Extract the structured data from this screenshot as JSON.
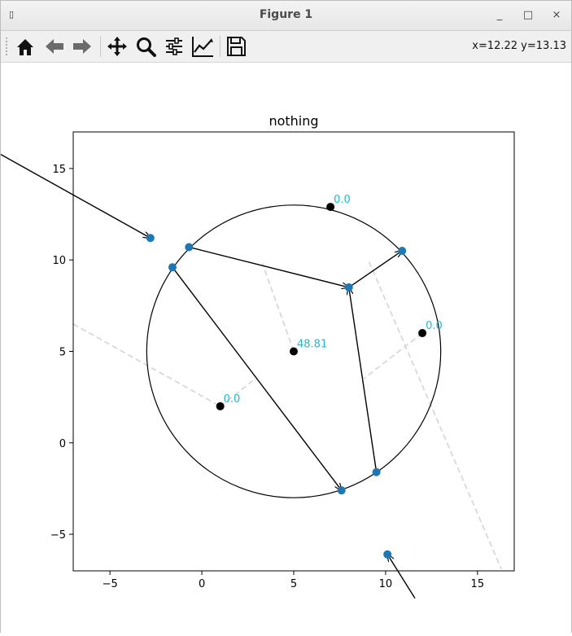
{
  "window": {
    "title": "Figure 1",
    "buttons": {
      "minimize": "_",
      "maximize": "□",
      "close": "×"
    }
  },
  "toolbar": {
    "items": [
      {
        "name": "home-icon"
      },
      {
        "name": "back-icon"
      },
      {
        "name": "forward-icon"
      },
      {
        "name": "pan-icon"
      },
      {
        "name": "zoom-icon"
      },
      {
        "name": "configure-subplots-icon"
      },
      {
        "name": "edit-axes-icon"
      },
      {
        "name": "save-icon"
      }
    ],
    "coords": "x=12.22 y=13.13"
  },
  "colors": {
    "blue_points": "#1f77b4",
    "black_points": "#000000",
    "label_color": "#17becf",
    "dashed_lines": "#d9d9d9"
  },
  "chart_data": {
    "type": "scatter",
    "title": "nothing",
    "xlim": [
      -7,
      17
    ],
    "ylim": [
      -7,
      17
    ],
    "xticks": [
      -5,
      0,
      5,
      10,
      15
    ],
    "yticks": [
      -5,
      0,
      5,
      10,
      15
    ],
    "circle": {
      "center": [
        5,
        5
      ],
      "radius": 8
    },
    "blue_points": [
      [
        -2.8,
        11.2
      ],
      [
        -0.7,
        10.7
      ],
      [
        -1.6,
        9.6
      ],
      [
        8.0,
        8.5
      ],
      [
        10.9,
        10.5
      ],
      [
        9.5,
        -1.6
      ],
      [
        7.6,
        -2.6
      ],
      [
        10.1,
        -6.1
      ]
    ],
    "black_points": [
      {
        "x": 7.0,
        "y": 12.9,
        "label": "0.0"
      },
      {
        "x": 12.0,
        "y": 6.0,
        "label": "0.0"
      },
      {
        "x": 5.0,
        "y": 5.0,
        "label": "48.81"
      },
      {
        "x": 1.0,
        "y": 2.0,
        "label": "0.0"
      }
    ],
    "arrows": [
      {
        "from": [
          -11.0,
          15.8
        ],
        "to": [
          -2.8,
          11.2
        ]
      },
      {
        "from": [
          -0.7,
          10.7
        ],
        "to": [
          8.0,
          8.5
        ]
      },
      {
        "from": [
          8.0,
          8.5
        ],
        "to": [
          10.9,
          10.5
        ]
      },
      {
        "from": [
          9.5,
          -1.6
        ],
        "to": [
          8.0,
          8.5
        ]
      },
      {
        "from": [
          -1.6,
          9.6
        ],
        "to": [
          7.6,
          -2.6
        ]
      },
      {
        "from": [
          11.6,
          -8.5
        ],
        "to": [
          10.1,
          -6.1
        ]
      }
    ],
    "dashed_lines": [
      {
        "from": [
          5.0,
          5.0
        ],
        "to": [
          3.3,
          9.8
        ]
      },
      {
        "from": [
          -7.0,
          6.5
        ],
        "to": [
          1.0,
          2.0
        ]
      },
      {
        "from": [
          1.0,
          2.0
        ],
        "to": [
          2.9,
          3.5
        ]
      },
      {
        "from": [
          12.0,
          6.0
        ],
        "to": [
          8.8,
          3.5
        ]
      },
      {
        "from": [
          9.1,
          9.9
        ],
        "to": [
          16.3,
          -6.9
        ]
      }
    ]
  }
}
